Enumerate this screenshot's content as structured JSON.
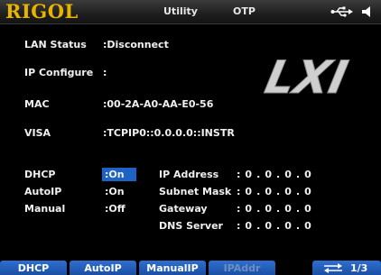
{
  "topbar": {
    "brand": "RIGOL",
    "mode": "Utility",
    "status": "OTP",
    "icons": [
      "usb-icon",
      "speaker-icon"
    ]
  },
  "info": {
    "lan_status": {
      "label": "LAN Status",
      "value": ":Disconnect"
    },
    "ip_configure": {
      "label": "IP Configure",
      "value": ":"
    },
    "mac": {
      "label": "MAC",
      "value": ":00-2A-A0-AA-E0-56"
    },
    "visa": {
      "label": "VISA",
      "value": ":TCPIP0::0.0.0.0::INSTR"
    },
    "logo": "LXI"
  },
  "config": {
    "dhcp": {
      "label": "DHCP",
      "value": ":On"
    },
    "autoip": {
      "label": "AutoIP",
      "value": ":On"
    },
    "manual": {
      "label": "Manual",
      "value": ":Off"
    }
  },
  "address": {
    "ip": {
      "label": "IP Address",
      "value": ": 0 . 0 . 0 . 0"
    },
    "mask": {
      "label": "Subnet Mask",
      "value": ": 0 . 0 . 0 . 0"
    },
    "gateway": {
      "label": "Gateway",
      "value": ": 0 . 0 . 0 . 0"
    },
    "dns": {
      "label": "DNS Server",
      "value": ": 0 . 0 . 0 . 0"
    }
  },
  "softkeys": {
    "dhcp": "DHCP",
    "autoip": "AutoIP",
    "manualip": "ManualIP",
    "ipaddr": "IPAddr",
    "page": "1/3"
  },
  "colors": {
    "brand": "#e8b400",
    "selection": "#1c63c4",
    "softkey": "#1a4fa4"
  }
}
